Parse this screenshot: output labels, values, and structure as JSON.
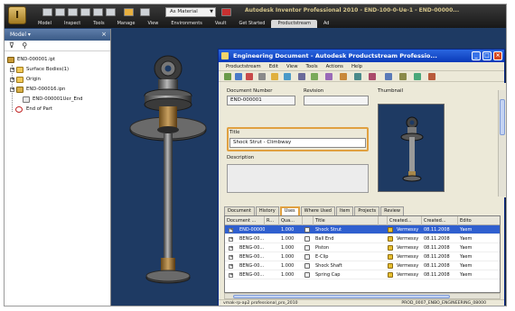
{
  "ribbon": {
    "material": "As Material",
    "title": "Autodesk Inventor Professional 2010 - END-100-0-Ue-1 - END-00000...",
    "tabs": [
      "Model",
      "Inspect",
      "Tools",
      "Manage",
      "View",
      "Environments",
      "Vault",
      "Get Started",
      "Productstream",
      "Ad"
    ],
    "active_tab": 8
  },
  "browser": {
    "header": "Model",
    "close": "×",
    "filter_icon": "funnel-icon",
    "search_icon": "binoculars-icon",
    "tree": [
      {
        "label": "END-000001.ipt",
        "icon": "assembly",
        "indent": 0
      },
      {
        "label": "Surface Bodies(1)",
        "icon": "folder",
        "indent": 1,
        "expander": "+"
      },
      {
        "label": "Origin",
        "icon": "folder",
        "indent": 1,
        "expander": "+"
      },
      {
        "label": "END-000016.ipn",
        "icon": "part",
        "indent": 1,
        "expander": "+"
      },
      {
        "label": "END-000001Uer_End",
        "icon": "part",
        "indent": 2
      },
      {
        "label": "End of Part",
        "icon": "end-of-part",
        "indent": 1
      }
    ]
  },
  "productstream": {
    "title": "Engineering Document - Autodesk Productstream Professio...",
    "menu": [
      "Productstream",
      "Edit",
      "View",
      "Tools",
      "Actions",
      "Help"
    ],
    "form": {
      "document_number_label": "Document Number",
      "document_number": "END-000001",
      "revision_label": "Revision",
      "revision": "",
      "thumbnail_label": "Thumbnail",
      "title_label": "Title",
      "title": "Shock Strut - Climbway",
      "description_label": "Description",
      "description": ""
    },
    "tabs": [
      "Document",
      "History",
      "Uses",
      "Where Used",
      "Item",
      "Projects",
      "Review"
    ],
    "active_tab": 2,
    "grid": {
      "columns": [
        "Document ...",
        "R...",
        "Qua...",
        "",
        "Title",
        "",
        "Created...",
        "Created...",
        "Edito"
      ],
      "rows": [
        {
          "doc": "END-00000...",
          "qty": "1.000",
          "title": "Shock Strut",
          "by": "Vermessy",
          "date": "08.11.2008",
          "ed": "Yaem",
          "selected": true
        },
        {
          "doc": "BENG-00...",
          "qty": "1.000",
          "title": "Ball End",
          "by": "Vermessy",
          "date": "08.11.2008",
          "ed": "Yaem",
          "selected": false
        },
        {
          "doc": "BENG-00...",
          "qty": "1.000",
          "title": "Piston",
          "by": "Vermessy",
          "date": "08.11.2008",
          "ed": "Yaem",
          "selected": false
        },
        {
          "doc": "BENG-00...",
          "qty": "1.000",
          "title": "E-Clip",
          "by": "Vermessy",
          "date": "08.11.2008",
          "ed": "Yaem",
          "selected": false
        },
        {
          "doc": "BENG-00...",
          "qty": "1.000",
          "title": "Shock Shaft",
          "by": "Vermessy",
          "date": "08.11.2008",
          "ed": "Yaem",
          "selected": false
        },
        {
          "doc": "BENG-00...",
          "qty": "1.000",
          "title": "Spring Cap",
          "by": "Vermessy",
          "date": "08.11.2008",
          "ed": "Yaem",
          "selected": false
        }
      ]
    },
    "status_left": "vmak-rp-ap2 professional_pro_2010",
    "status_right": "PROD_0007_ENBO_ENGINEERING_08000"
  },
  "colors": {
    "viewport": "#1e3a63",
    "selection": "#2f5fcf",
    "highlight": "#e0a040"
  }
}
